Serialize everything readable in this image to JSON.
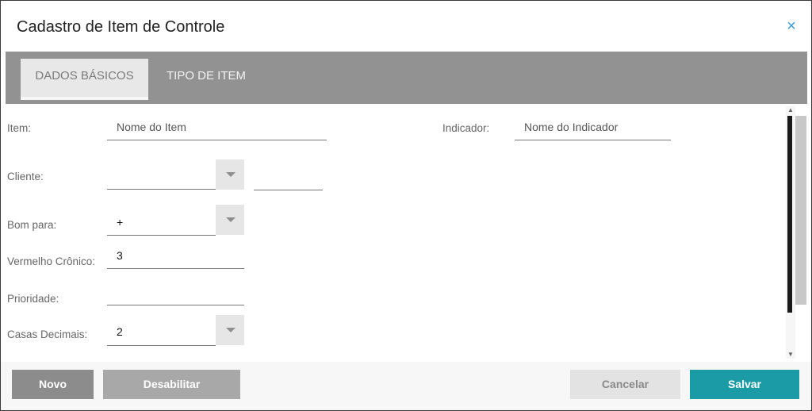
{
  "dialog": {
    "title": "Cadastro de Item de Controle",
    "close_icon": "×"
  },
  "tabs": [
    {
      "label": "DADOS BÁSICOS"
    },
    {
      "label": "TIPO DE ITEM"
    }
  ],
  "form": {
    "item": {
      "label": "Item:",
      "placeholder": "Nome do Item"
    },
    "indicador": {
      "label": "Indicador:",
      "placeholder": "Nome do Indicador"
    },
    "cliente": {
      "label": "Cliente:",
      "value": ""
    },
    "bom_para": {
      "label": "Bom para:",
      "value": "+"
    },
    "vermelho_cronico": {
      "label": "Vermelho Crônico:",
      "value": "3"
    },
    "prioridade": {
      "label": "Prioridade:",
      "value": ""
    },
    "casas_decimais": {
      "label": "Casas Decimais:",
      "value": "2"
    }
  },
  "buttons": {
    "novo": "Novo",
    "desabilitar": "Desabilitar",
    "cancelar": "Cancelar",
    "salvar": "Salvar"
  },
  "colors": {
    "accent": "#1a9ba6",
    "tabbar": "#929292",
    "close": "#3a9ad9"
  }
}
